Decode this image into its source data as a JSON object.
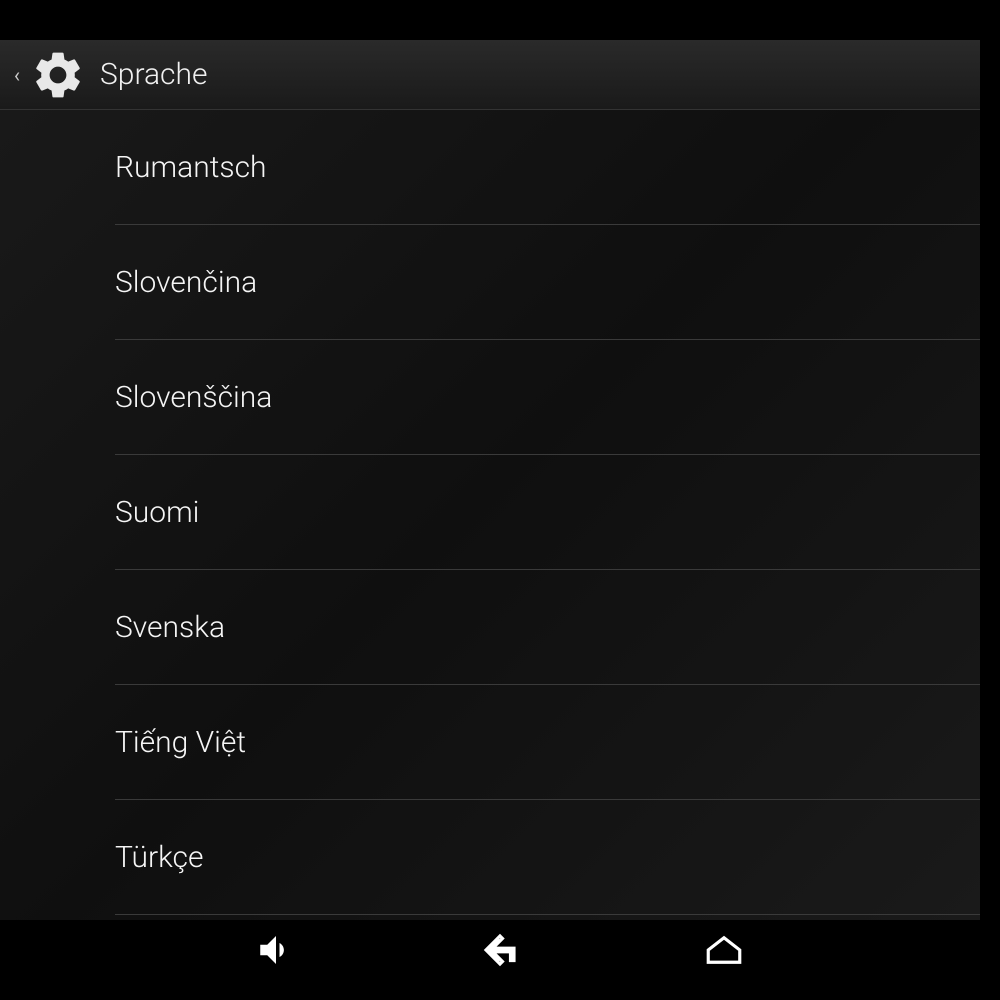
{
  "header": {
    "title": "Sprache"
  },
  "languages": [
    {
      "label": "Rumantsch"
    },
    {
      "label": "Slovenčina"
    },
    {
      "label": "Slovenščina"
    },
    {
      "label": "Suomi"
    },
    {
      "label": "Svenska"
    },
    {
      "label": "Tiếng Việt"
    },
    {
      "label": "Türkçe"
    }
  ]
}
